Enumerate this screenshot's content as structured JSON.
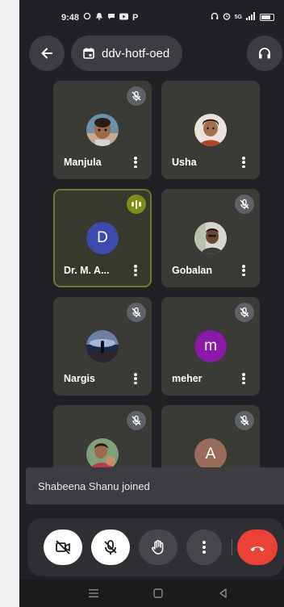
{
  "status_bar": {
    "time": "9:48",
    "left_icons": [
      "alarm-icon",
      "notification-bell-icon",
      "chat-icon",
      "youtube-icon"
    ],
    "left_letter": "P",
    "right_icons": [
      "headphones-icon",
      "alarm-clock-icon",
      "signal-icon",
      "battery-icon"
    ],
    "network_label": "5G"
  },
  "header": {
    "meeting_code": "ddv-hotf-oed"
  },
  "participants": [
    {
      "name": "Manjula",
      "muted": true,
      "avatar_type": "photo"
    },
    {
      "name": "Usha",
      "muted": false,
      "avatar_type": "photo"
    },
    {
      "name": "Dr. M. A...",
      "muted": false,
      "speaking": true,
      "avatar_letter": "D",
      "avatar_color": "#3d4bb0"
    },
    {
      "name": "Gobalan",
      "muted": true,
      "avatar_type": "photo"
    },
    {
      "name": "Nargis",
      "muted": true,
      "avatar_type": "photo"
    },
    {
      "name": "meher",
      "muted": true,
      "avatar_letter": "m",
      "avatar_color": "#8a1aa8"
    },
    {
      "name": "",
      "muted": true,
      "avatar_type": "photo"
    },
    {
      "name": "",
      "muted": true,
      "avatar_letter": "A",
      "avatar_color": "#9a6c5b"
    }
  ],
  "toast": {
    "message": "Shabeena Shanu joined"
  },
  "controls": {
    "camera": "camera-off-icon",
    "mic": "mic-off-icon",
    "hand": "raise-hand-icon",
    "more": "more-options-icon",
    "end_call": "end-call-icon"
  },
  "colors": {
    "background": "#202124",
    "tile": "#3a3b36",
    "speaking_accent": "#7d8c1d",
    "end_call": "#ea4335"
  }
}
